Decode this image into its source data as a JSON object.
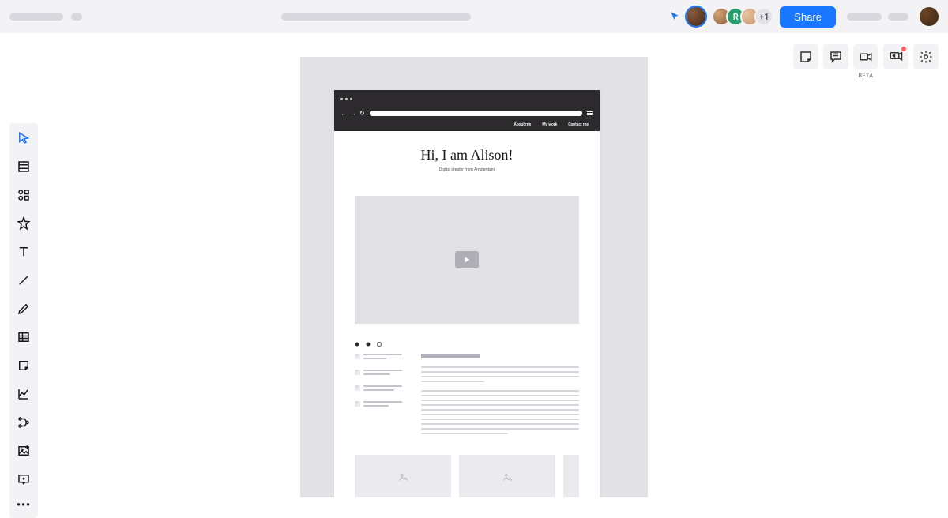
{
  "topbar": {
    "share_label": "Share",
    "overflow_count": "+1"
  },
  "right_panel": {
    "beta_label": "BETA"
  },
  "mockup": {
    "nav": {
      "about": "About me",
      "work": "My work",
      "contact": "Contact me"
    },
    "hero": {
      "title": "Hi, I am Alison!",
      "subtitle": "Digital creator from Amsterdam"
    }
  }
}
